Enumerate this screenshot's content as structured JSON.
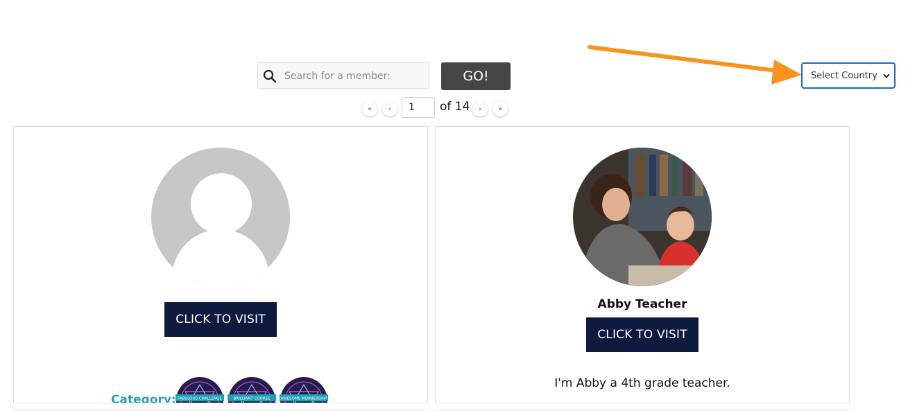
{
  "search": {
    "placeholder": "Search for a member:",
    "go_label": "GO!"
  },
  "country_select": {
    "selected": "Select Country"
  },
  "pagination": {
    "first": "«",
    "prev": "‹",
    "current_page": "1",
    "of_text": "of 14",
    "next": "›",
    "last": "»"
  },
  "members": [
    {
      "name": "",
      "visit_label": "CLICK TO VISIT",
      "category_label": "Category:",
      "badges": [
        "FABULOUS CHALLENGE",
        "BRILLIANT COURSE",
        "AWESOME MEMBERSHIP"
      ]
    },
    {
      "name": "Abby Teacher",
      "visit_label": "CLICK TO VISIT",
      "description": "I'm Abby a 4th grade teacher."
    }
  ],
  "colors": {
    "go_button": "#454545",
    "visit_button": "#0e1a3e",
    "select_border": "#1a66d2",
    "arrow": "#f7931e",
    "category": "#2a9fb5"
  }
}
